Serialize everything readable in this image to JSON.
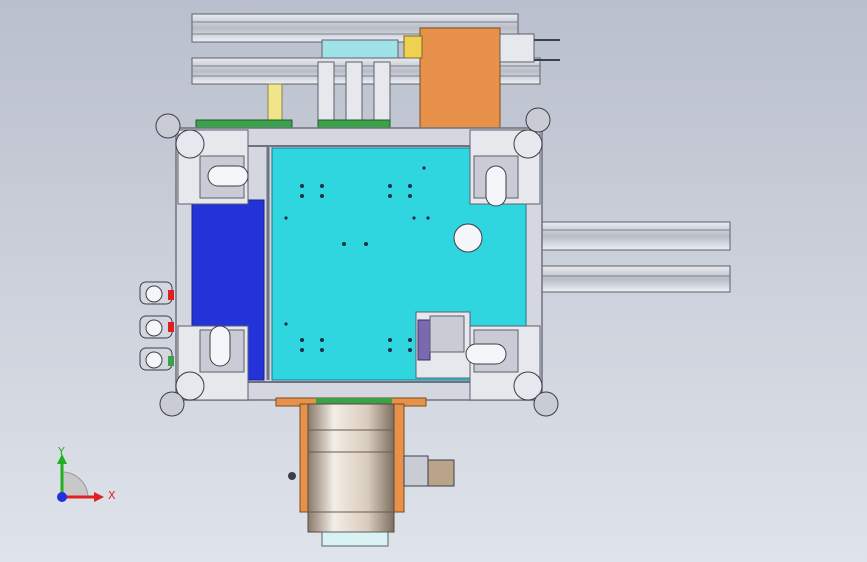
{
  "viewport": {
    "background_top": "#b9bfcc",
    "background_bottom": "#dfe3ea"
  },
  "colors": {
    "frame": "#d4d7df",
    "frame_edge": "#6d7280",
    "plate_cyan": "#2fd6e0",
    "panel_blue": "#2433d9",
    "orange": "#e8914a",
    "green": "#3aa34a",
    "yellow": "#f0e58a",
    "dark": "#3b3f48",
    "motor_tan": "#b9a48a"
  },
  "triad": {
    "x_label": "X",
    "y_label": "Y",
    "x_color": "#e02020",
    "y_color": "#20b020",
    "z_color": "#2030e0"
  }
}
